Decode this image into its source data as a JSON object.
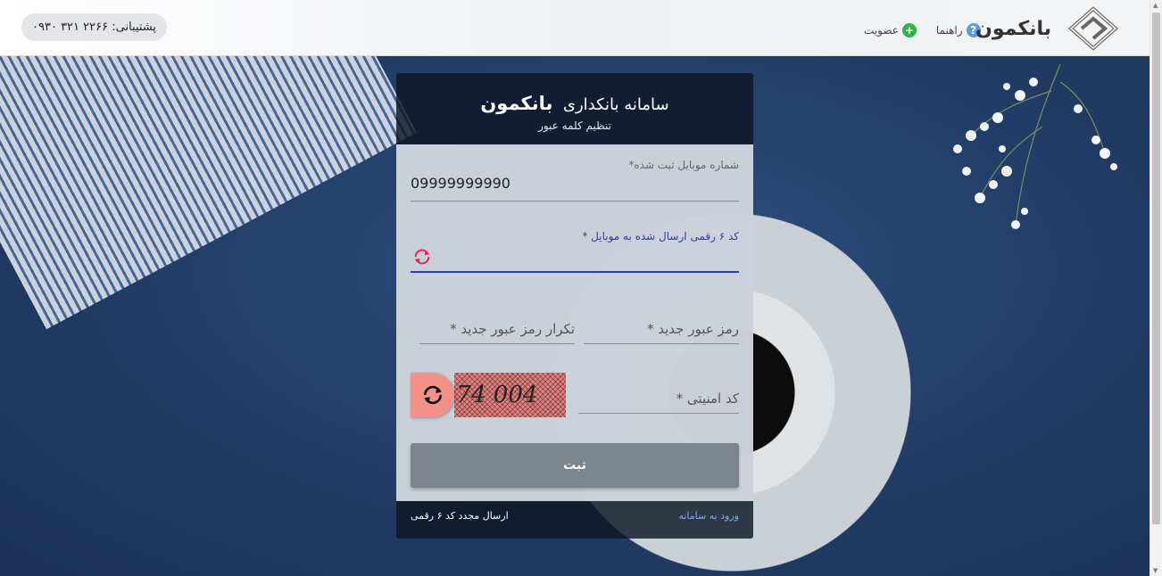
{
  "header": {
    "support_text": "پشتیبانی: ۲۲۶۶ ۳۲۱ ۰۹۳۰",
    "brand_name": "بانکمون",
    "nav": {
      "help_label": "راهنما",
      "signup_label": "عضویت"
    }
  },
  "card": {
    "title_prefix": "سامانه بانکداری",
    "title_brand": "بانکمون",
    "subtitle": "تنظیم کلمه عبور",
    "mobile": {
      "label": "شماره موبایل ثبت شده*",
      "value": "09999999990"
    },
    "code": {
      "label": "کد ۶ رقمی ارسال شده به موبایل *"
    },
    "new_password": {
      "placeholder": "رمز عبور جدید *"
    },
    "repeat_password": {
      "placeholder": "تکرار رمز عبور جدید *"
    },
    "captcha": {
      "placeholder": "کد امنیتی *",
      "image_text": "74 004"
    },
    "submit_label": "ثبت",
    "footer": {
      "login_link": "ورود به سامانه",
      "resend_link": "ارسال مجدد کد ۶ رقمی"
    }
  },
  "colors": {
    "accent_blue": "#2f3fa8",
    "refresh_red": "#e5245b",
    "link_blue": "#7aaef0",
    "help_icon": "#5b9bdf",
    "signup_icon": "#2fb344"
  },
  "icons": {
    "help": "question-circle-icon",
    "signup": "plus-circle-icon",
    "refresh": "refresh-icon",
    "logo": "bank-logo-icon"
  }
}
